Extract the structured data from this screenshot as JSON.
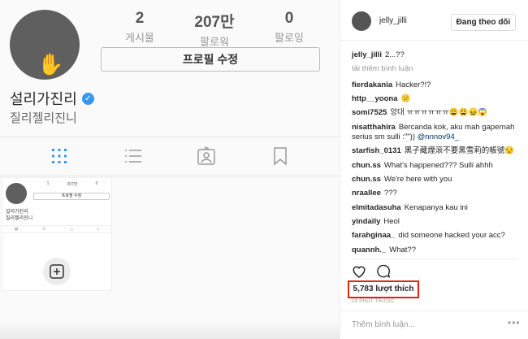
{
  "profile": {
    "stats": [
      {
        "num": "2",
        "label": "게시물"
      },
      {
        "num": "207만",
        "label": "팔로워"
      },
      {
        "num": "0",
        "label": "팔로잉"
      }
    ],
    "edit_button": "프로필 수정",
    "name": "설리가진리",
    "bio": "질리젤리진니"
  },
  "thumbnail": {
    "stats": [
      "1",
      "207만",
      "0"
    ],
    "edit_button": "프로필 수정",
    "name": "설리가진리",
    "bio": "질리젤리진니"
  },
  "post": {
    "username": "jelly_jilli",
    "follow_button": "Đang theo dõi",
    "load_more": "tải thêm bình luận",
    "caption": {
      "user": "jelly_jilli",
      "text": "2...??"
    },
    "comments": [
      {
        "user": "fierdakania",
        "text": "Hacker?!?"
      },
      {
        "user": "http__yoona",
        "text": "😕"
      },
      {
        "user": "somi7525",
        "text": "앙대 ㅠㅠㅠㅠㅠㅠ😩😩😖😱"
      },
      {
        "user": "nisatthahira",
        "text": "Bercanda kok, aku mah gapernah serius sm sulli :\"\"))",
        "mention": "@nnnov94_"
      },
      {
        "user": "starfish_0131",
        "text": "黑子藏煙滾不要黑雪莉的帳號😒"
      },
      {
        "user": "chun.ss",
        "text": "What's happened??? Sulli ahhh"
      },
      {
        "user": "chun.ss",
        "text": "We're here with you"
      },
      {
        "user": "nraallee",
        "text": "???"
      },
      {
        "user": "elmitadasuha",
        "text": "Kenapanya kau ini"
      },
      {
        "user": "yindaily",
        "text": "Heol"
      },
      {
        "user": "farahginaa_",
        "text": "did someone hacked your acc?"
      },
      {
        "user": "quannh._",
        "text": "What??"
      }
    ],
    "likes": "5,783 lượt thích",
    "time": "29 PHÚT TRƯỚC",
    "add_comment_placeholder": "Thêm bình luận...",
    "more": "•••"
  }
}
